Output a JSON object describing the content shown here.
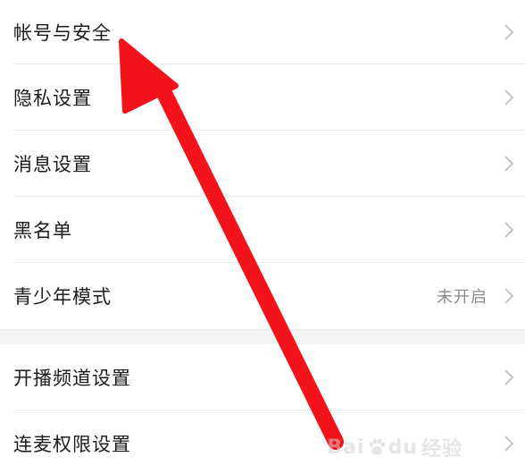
{
  "settings": {
    "group1": [
      {
        "label": "帐号与安全",
        "value": ""
      },
      {
        "label": "隐私设置",
        "value": ""
      },
      {
        "label": "消息设置",
        "value": ""
      },
      {
        "label": "黑名单",
        "value": ""
      },
      {
        "label": "青少年模式",
        "value": "未开启"
      }
    ],
    "group2": [
      {
        "label": "开播频道设置",
        "value": ""
      },
      {
        "label": "连麦权限设置",
        "value": ""
      }
    ]
  },
  "annotation": {
    "color": "#f2131b",
    "points_to": "帐号与安全"
  },
  "watermark": {
    "brand_left": "Bai",
    "brand_right": "du",
    "suffix": "经验"
  },
  "icons": {
    "row_chevron": "chevron-right-icon",
    "watermark_paw": "baidu-paw-icon"
  },
  "colors": {
    "label": "#1c1c1c",
    "value": "#8a8a8a",
    "chevron": "#c4c4c4",
    "section_gap": "#f2f3f5"
  }
}
